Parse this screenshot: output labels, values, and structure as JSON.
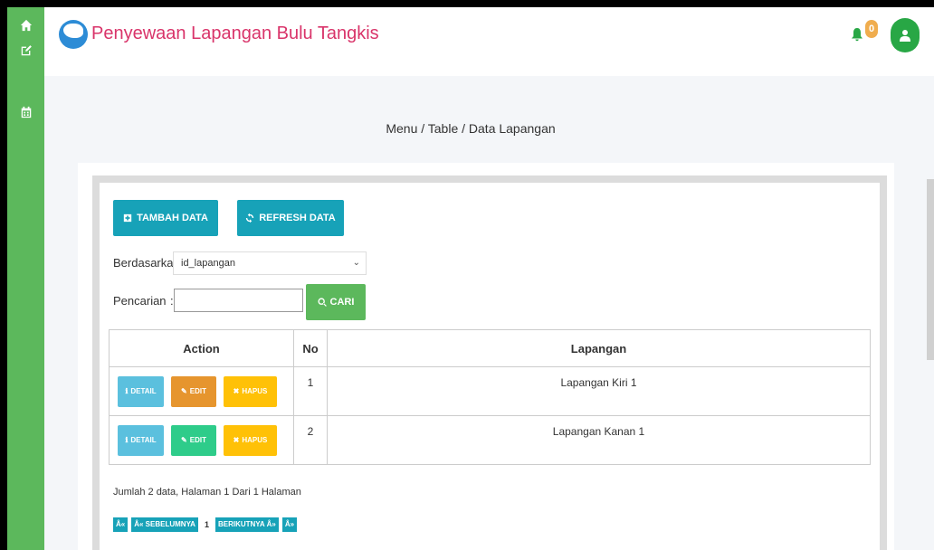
{
  "app": {
    "title": "Penyewaan Lapangan Bulu Tangkis",
    "notification_count": "0"
  },
  "sidebar": {
    "items": [
      {
        "icon": "home-icon"
      },
      {
        "icon": "edit-icon"
      },
      {
        "icon": "calendar-icon"
      }
    ]
  },
  "breadcrumb": "Menu / Table / Data Lapangan",
  "toolbar": {
    "tambah_label": "TAMBAH DATA",
    "refresh_label": "REFRESH DATA"
  },
  "filter": {
    "berdasarkan_label": "Berdasarkan:",
    "berdasarkan_value": "id_lapangan",
    "pencarian_label": "Pencarian",
    "pencarian_sep": ":",
    "search_value": "",
    "cari_label": "CARI"
  },
  "table": {
    "headers": {
      "action": "Action",
      "no": "No",
      "lapangan": "Lapangan"
    },
    "rows": [
      {
        "no": "1",
        "lapangan": "Lapangan Kiri 1",
        "detail": "DETAIL",
        "edit": "EDIT",
        "hapus": "HAPUS",
        "edit_color": "#e6952e"
      },
      {
        "no": "2",
        "lapangan": "Lapangan Kanan 1",
        "detail": "DETAIL",
        "edit": "EDIT",
        "hapus": "HAPUS",
        "edit_color": "#2ecc8a"
      }
    ]
  },
  "summary": "Jumlah 2 data, Halaman 1 Dari 1 Halaman",
  "pagination": {
    "first": "Â«",
    "prev": "Â« SEBELUMNYA",
    "current": "1",
    "next": "BERIKUTNYA Â»",
    "last": "Â»"
  },
  "colors": {
    "sidebar": "#5cb85c",
    "title": "#d9346a",
    "info": "#17a2b8",
    "success": "#5cb85c",
    "warning": "#ffc107"
  }
}
